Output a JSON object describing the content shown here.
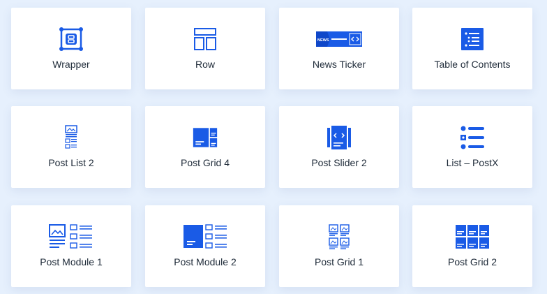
{
  "accent_color": "#1a5be6",
  "blocks": [
    {
      "label": "Wrapper",
      "icon": "wrapper-icon"
    },
    {
      "label": "Row",
      "icon": "row-layout-icon"
    },
    {
      "label": "News Ticker",
      "icon": "news-ticker-icon",
      "icon_text": "NEWS"
    },
    {
      "label": "Table of Contents",
      "icon": "table-of-contents-icon"
    },
    {
      "label": "Post List 2",
      "icon": "post-list-icon"
    },
    {
      "label": "Post Grid 4",
      "icon": "post-grid-4-icon"
    },
    {
      "label": "Post Slider 2",
      "icon": "post-slider-icon"
    },
    {
      "label": "List – PostX",
      "icon": "bullet-list-icon"
    },
    {
      "label": "Post Module 1",
      "icon": "post-module-1-icon"
    },
    {
      "label": "Post Module 2",
      "icon": "post-module-2-icon"
    },
    {
      "label": "Post Grid 1",
      "icon": "post-grid-1-icon"
    },
    {
      "label": "Post Grid 2",
      "icon": "post-grid-2-icon"
    }
  ]
}
